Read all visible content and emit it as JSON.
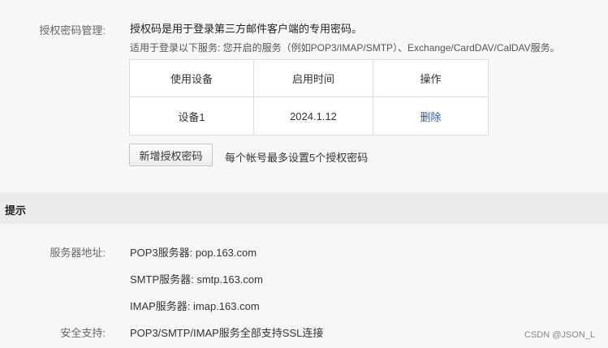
{
  "auth": {
    "label": "授权密码管理:",
    "intro_line1": "授权码是用于登录第三方邮件客户端的专用密码。",
    "intro_line2": "适用于登录以下服务: 您开启的服务（例如POP3/IMAP/SMTP）、Exchange/CardDAV/CalDAV服务。",
    "table": {
      "headers": [
        "使用设备",
        "启用时间",
        "操作"
      ],
      "rows": [
        {
          "device": "设备1",
          "date": "2024.1.12",
          "action": "删除"
        }
      ]
    },
    "add_button": "新增授权密码",
    "max_note": "每个帐号最多设置5个授权密码"
  },
  "tips": {
    "title": "提示",
    "server_label": "服务器地址:",
    "pop3": "POP3服务器: pop.163.com",
    "smtp": "SMTP服务器: smtp.163.com",
    "imap": "IMAP服务器: imap.163.com",
    "security_label": "安全支持:",
    "ssl": "POP3/SMTP/IMAP服务全部支持SSL连接"
  },
  "watermark": "CSDN @JSON_L"
}
